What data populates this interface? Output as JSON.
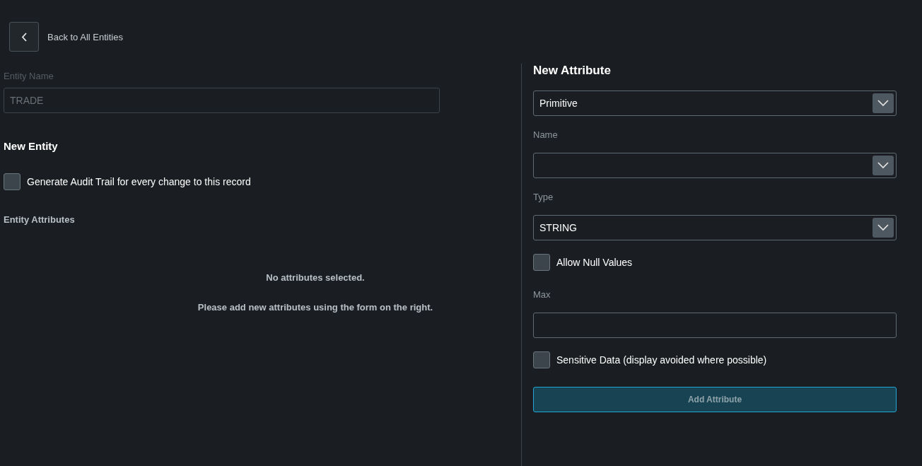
{
  "back_button": {
    "label": "Back to All Entities"
  },
  "entity_name": {
    "label": "Entity Name",
    "value": "TRADE",
    "disabled": true
  },
  "entity": {
    "title": "New Entity",
    "audit_trail": {
      "label": "Generate Audit Trail for every change to this record",
      "checked": false
    },
    "attributes_heading": "Entity Attributes",
    "empty_messages": [
      "No attributes selected.",
      "Please add new attributes using the form on the right."
    ]
  },
  "new_attribute": {
    "title": "New Attribute",
    "fields": [
      {
        "kind": "select",
        "value": "Primitive"
      },
      {
        "kind": "select",
        "label": "Name"
      },
      {
        "kind": "select",
        "label": "Type",
        "value": "STRING"
      },
      {
        "kind": "checkbox",
        "label": "Allow Null Values",
        "checked": false
      },
      {
        "kind": "input",
        "label": "Max"
      },
      {
        "kind": "checkbox",
        "label": "Sensitive Data (display avoided where possible)",
        "checked": false
      }
    ],
    "submit": {
      "label": "Add Attribute",
      "disabled": true
    }
  }
}
